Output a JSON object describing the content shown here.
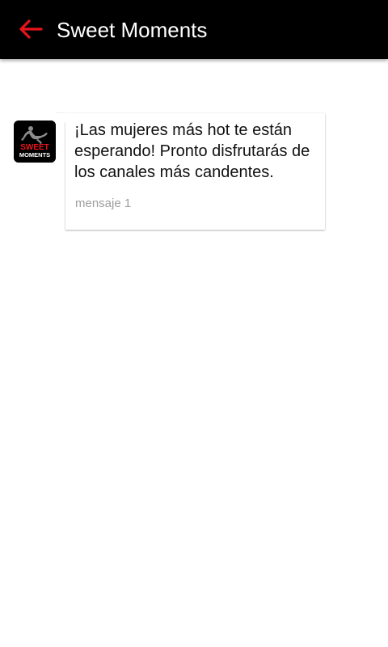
{
  "app_bar": {
    "title": "Sweet Moments",
    "back_icon": "arrow-left-icon",
    "back_icon_color": "#e8141c",
    "background": "#000000"
  },
  "message": {
    "avatar": {
      "logo_text_line1": "SWEET",
      "logo_text_line2": "MOMENTS"
    },
    "text": "¡Las mujeres más hot te están esperando! Pronto disfrutarás de los canales más candentes.",
    "meta": "mensaje 1"
  }
}
